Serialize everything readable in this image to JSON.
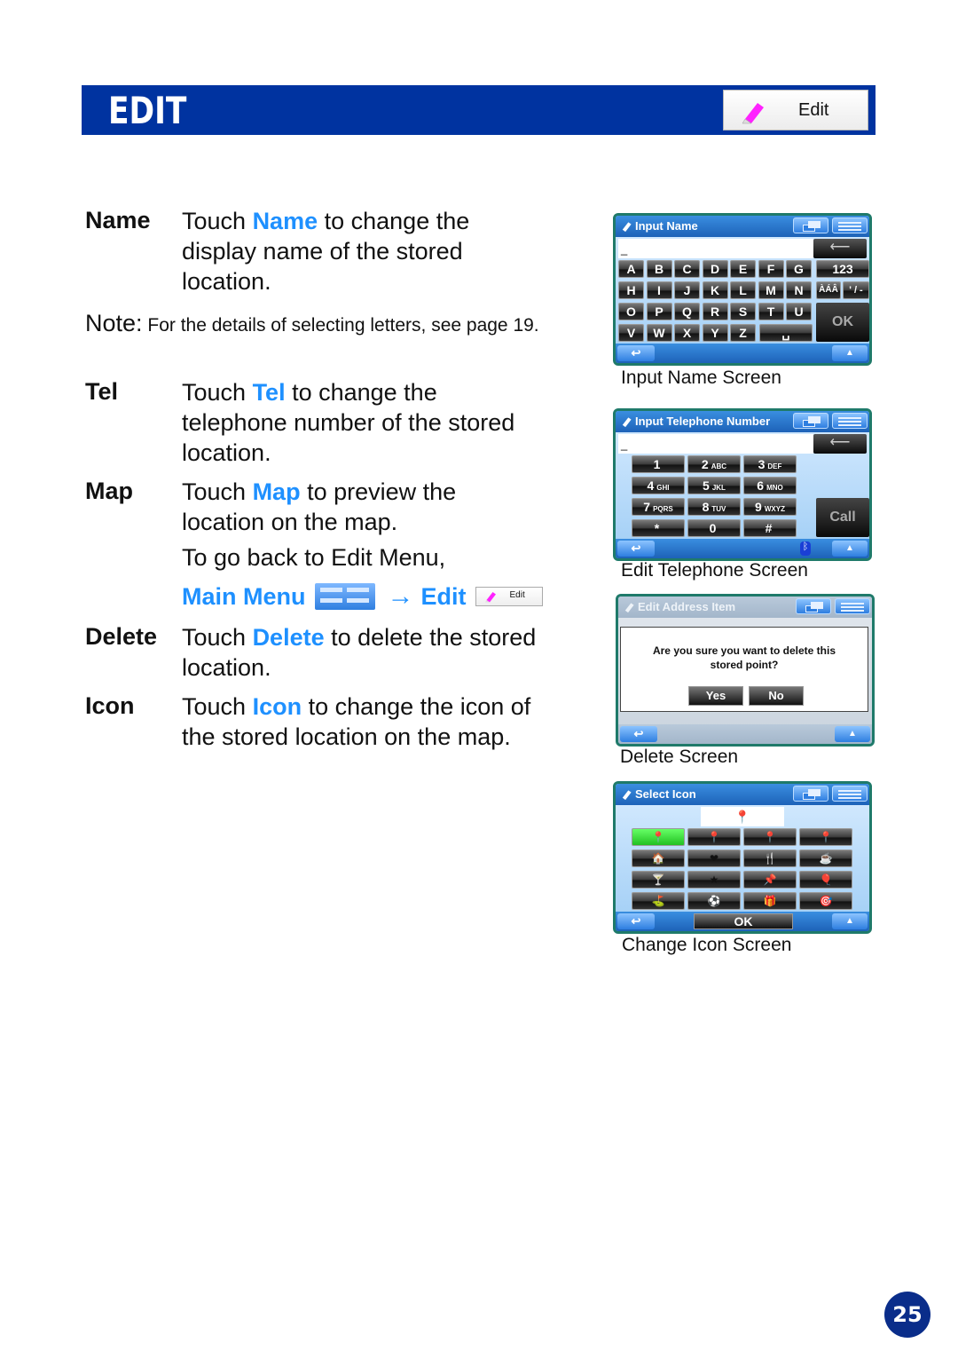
{
  "header": {
    "title": "EDIT",
    "button_label": "Edit",
    "button_icon": "pencil-icon",
    "color": "#0033a0"
  },
  "entries": [
    {
      "term": "Name",
      "pre": "Touch ",
      "highlight": "Name",
      "post": " to change the",
      "line2": "display name of the stored",
      "line3": "location."
    },
    {
      "term": "Tel",
      "pre": "Touch ",
      "highlight": "Tel",
      "post": " to change the",
      "line2": "telephone number of the stored",
      "line3": "location."
    },
    {
      "term": "Map",
      "pre": "Touch ",
      "highlight": "Map",
      "post": " to preview the",
      "line2": "location on the map.",
      "line3": "To go back to Edit Menu,"
    },
    {
      "term": "Delete",
      "pre": "Touch ",
      "highlight": "Delete",
      "post": " to delete the stored",
      "line2": "location."
    },
    {
      "term": "Icon",
      "pre": "Touch ",
      "highlight": "Icon",
      "post": " to change the icon of",
      "line2": "the stored location on the map."
    }
  ],
  "note": {
    "label": "Note:",
    "text": " For the details of selecting letters, see page 19."
  },
  "nav_path": {
    "step1": "Main Menu",
    "step1_icon": "main-menu-icon",
    "arrow": "→",
    "step2": "Edit",
    "step2_button": "Edit"
  },
  "highlight_color": "#1e90ff",
  "screens": {
    "input_name": {
      "title": "Input Name",
      "field_value": "_",
      "keys_row1": [
        "A",
        "B",
        "C",
        "D",
        "E",
        "F",
        "G"
      ],
      "keys_row2": [
        "H",
        "I",
        "J",
        "K",
        "L",
        "M",
        "N"
      ],
      "keys_row3": [
        "O",
        "P",
        "Q",
        "R",
        "S",
        "T",
        "U"
      ],
      "keys_row4": [
        "V",
        "W",
        "X",
        "Y",
        "Z"
      ],
      "key_123": "123",
      "key_accents": "ÀÁÂ",
      "key_symbols": "' / -",
      "key_space": "␣",
      "key_ok": "OK",
      "backspace": "⟵",
      "caption": "Input Name Screen"
    },
    "input_tel": {
      "title": "Input Telephone Number",
      "field_value": "_",
      "keys": [
        {
          "num": "1",
          "letters": ""
        },
        {
          "num": "2",
          "letters": "ABC"
        },
        {
          "num": "3",
          "letters": "DEF"
        },
        {
          "num": "4",
          "letters": "GHI"
        },
        {
          "num": "5",
          "letters": "JKL"
        },
        {
          "num": "6",
          "letters": "MNO"
        },
        {
          "num": "7",
          "letters": "PQRS"
        },
        {
          "num": "8",
          "letters": "TUV"
        },
        {
          "num": "9",
          "letters": "WXYZ"
        },
        {
          "num": "*",
          "letters": ""
        },
        {
          "num": "0",
          "letters": ""
        },
        {
          "num": "#",
          "letters": ""
        }
      ],
      "call": "Call",
      "backspace": "⟵",
      "bluetooth": "ᛒ",
      "caption": "Edit Telephone Screen"
    },
    "delete": {
      "title": "Edit Address Item",
      "message_line1": "Are you sure you want to delete this",
      "message_line2": "stored point?",
      "yes": "Yes",
      "no": "No",
      "caption": "Delete Screen"
    },
    "select_icon": {
      "title": "Select Icon",
      "preview": "📍",
      "icons": [
        "📍",
        "📍",
        "📍",
        "📍",
        "🏠",
        "❤",
        "🍴",
        "☕",
        "🍸",
        "★",
        "📌",
        "🎈",
        "⛳",
        "⚽",
        "🎁",
        "🎯"
      ],
      "ok": "OK",
      "caption": "Change Icon Screen"
    },
    "back": "↩",
    "nav": "▲"
  },
  "page_number": "25"
}
